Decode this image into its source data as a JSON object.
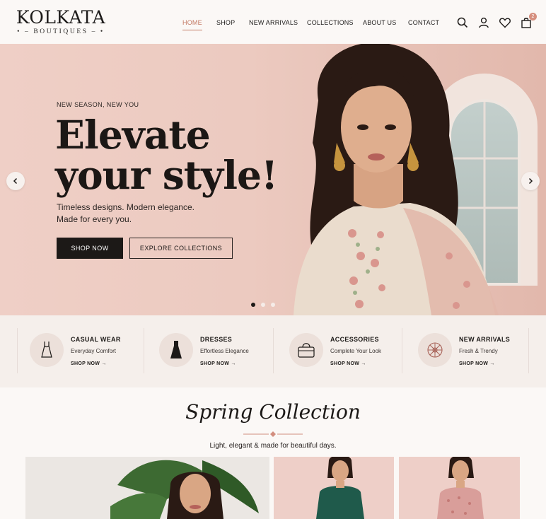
{
  "brand": {
    "name": "KOLKATA",
    "tagline": "BOUTIQUES"
  },
  "nav": [
    {
      "label": "HOME",
      "active": true
    },
    {
      "label": "SHOP",
      "active": false
    },
    {
      "label": "NEW ARRIVALS",
      "active": false
    },
    {
      "label": "COLLECTIONS",
      "active": false
    },
    {
      "label": "ABOUT US",
      "active": false
    },
    {
      "label": "CONTACT",
      "active": false
    }
  ],
  "header_icons": [
    "search-icon",
    "user-icon",
    "heart-icon",
    "bag-icon"
  ],
  "cart_count": "2",
  "hero": {
    "eyebrow": "NEW SEASON, NEW YOU",
    "headline_line1": "Elevate",
    "headline_line2": "your style!",
    "sub_line1": "Timeless designs. Modern elegance.",
    "sub_line2": "Made for every you.",
    "primary_cta": "SHOP NOW",
    "secondary_cta": "EXPLORE COLLECTIONS",
    "slides": 3,
    "active_slide": 1
  },
  "categories": [
    {
      "title": "CASUAL WEAR",
      "subtitle": "Everyday Comfort",
      "link": "SHOP NOW",
      "icon": "casual-dress-icon"
    },
    {
      "title": "DRESSES",
      "subtitle": "Effortless Elegance",
      "link": "SHOP NOW",
      "icon": "dress-icon"
    },
    {
      "title": "ACCESSORIES",
      "subtitle": "Complete Your Look",
      "link": "SHOP NOW",
      "icon": "handbag-icon"
    },
    {
      "title": "NEW ARRIVALS",
      "subtitle": "Fresh & Trendy",
      "link": "SHOP NOW",
      "icon": "starburst-icon"
    }
  ],
  "spring": {
    "title": "Spring Collection",
    "subtitle": "Light, elegant & made for beautiful days."
  },
  "colors": {
    "accent": "#c47a65",
    "dark": "#1c1917",
    "hero_bg": "#eccac0",
    "page_bg": "#fbf8f6"
  }
}
